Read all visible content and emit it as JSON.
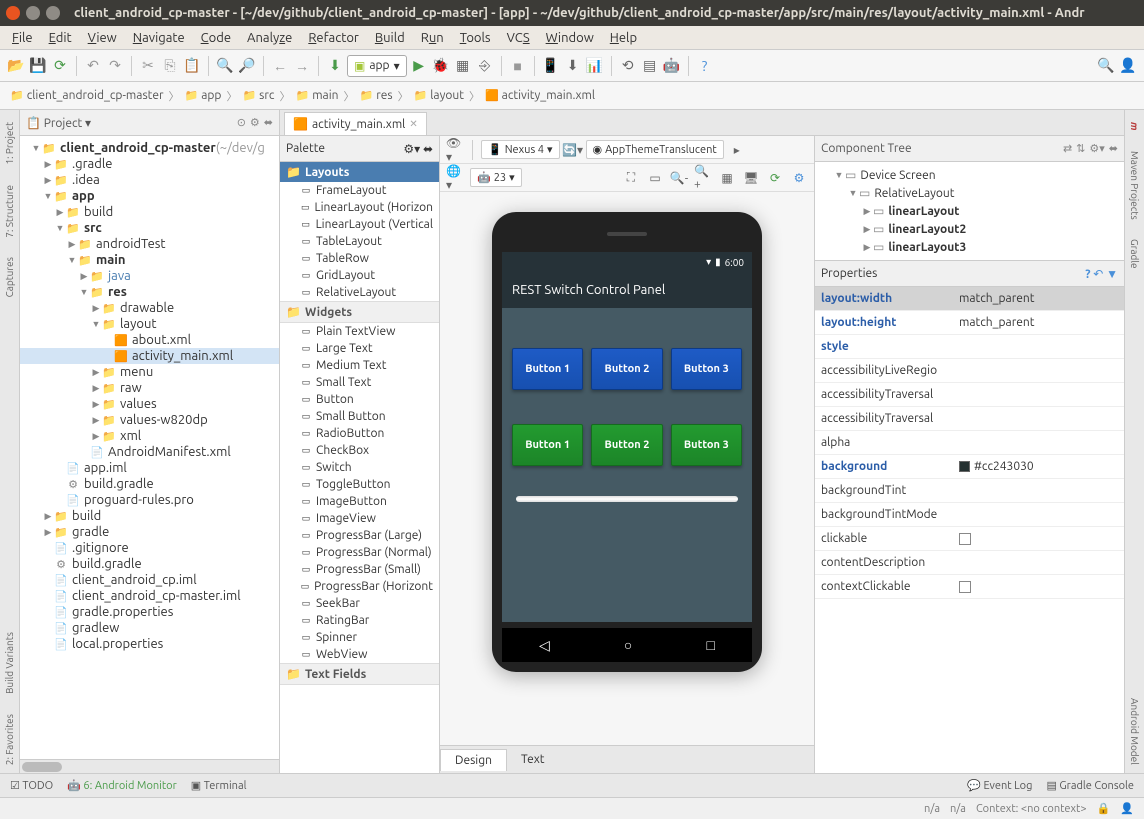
{
  "window": {
    "title": "client_android_cp-master - [~/dev/github/client_android_cp-master] - [app] - ~/dev/github/client_android_cp-master/app/src/main/res/layout/activity_main.xml - Andr"
  },
  "menu": [
    "File",
    "Edit",
    "View",
    "Navigate",
    "Code",
    "Analyze",
    "Refactor",
    "Build",
    "Run",
    "Tools",
    "VCS",
    "Window",
    "Help"
  ],
  "toolbar_app_combo": "app",
  "breadcrumb": [
    {
      "icon": "📁",
      "label": "client_android_cp-master"
    },
    {
      "icon": "📁",
      "label": "app"
    },
    {
      "icon": "📁",
      "label": "src"
    },
    {
      "icon": "📁",
      "label": "main"
    },
    {
      "icon": "📁",
      "label": "res"
    },
    {
      "icon": "📁",
      "label": "layout"
    },
    {
      "icon": "🟧",
      "label": "activity_main.xml"
    }
  ],
  "left_tabs": [
    "1: Project",
    "7: Structure",
    "Captures",
    "Build Variants",
    "2: Favorites"
  ],
  "right_tabs": [
    "Maven Projects",
    "Gradle",
    "Android Model"
  ],
  "project_panel": {
    "header": "Project",
    "tree": [
      {
        "pad": 1,
        "toggle": "▼",
        "ico": "📁",
        "label": "client_android_cp-master",
        "extra": " (~/dev/g",
        "bold": true
      },
      {
        "pad": 2,
        "toggle": "▶",
        "ico": "📁",
        "label": ".gradle"
      },
      {
        "pad": 2,
        "toggle": "▶",
        "ico": "📁",
        "label": ".idea"
      },
      {
        "pad": 2,
        "toggle": "▼",
        "ico": "📁",
        "label": "app",
        "bold": true
      },
      {
        "pad": 3,
        "toggle": "▶",
        "ico": "📁",
        "label": "build"
      },
      {
        "pad": 3,
        "toggle": "▼",
        "ico": "📁",
        "label": "src",
        "bold": true
      },
      {
        "pad": 4,
        "toggle": "▶",
        "ico": "📁",
        "label": "androidTest"
      },
      {
        "pad": 4,
        "toggle": "▼",
        "ico": "📁",
        "label": "main",
        "bold": true
      },
      {
        "pad": 5,
        "toggle": "▶",
        "ico": "📁",
        "label": "java",
        "blue": true
      },
      {
        "pad": 5,
        "toggle": "▼",
        "ico": "📁",
        "label": "res",
        "bold": true
      },
      {
        "pad": 6,
        "toggle": "▶",
        "ico": "📁",
        "label": "drawable"
      },
      {
        "pad": 6,
        "toggle": "▼",
        "ico": "📁",
        "label": "layout"
      },
      {
        "pad": 7,
        "toggle": "",
        "ico": "🟧",
        "label": "about.xml"
      },
      {
        "pad": 7,
        "toggle": "",
        "ico": "🟧",
        "label": "activity_main.xml",
        "selected": true
      },
      {
        "pad": 6,
        "toggle": "▶",
        "ico": "📁",
        "label": "menu"
      },
      {
        "pad": 6,
        "toggle": "▶",
        "ico": "📁",
        "label": "raw"
      },
      {
        "pad": 6,
        "toggle": "▶",
        "ico": "📁",
        "label": "values"
      },
      {
        "pad": 6,
        "toggle": "▶",
        "ico": "📁",
        "label": "values-w820dp"
      },
      {
        "pad": 6,
        "toggle": "▶",
        "ico": "📁",
        "label": "xml"
      },
      {
        "pad": 5,
        "toggle": "",
        "ico": "📄",
        "label": "AndroidManifest.xml"
      },
      {
        "pad": 3,
        "toggle": "",
        "ico": "📄",
        "label": "app.iml"
      },
      {
        "pad": 3,
        "toggle": "",
        "ico": "⚙",
        "label": "build.gradle"
      },
      {
        "pad": 3,
        "toggle": "",
        "ico": "📄",
        "label": "proguard-rules.pro"
      },
      {
        "pad": 2,
        "toggle": "▶",
        "ico": "📁",
        "label": "build"
      },
      {
        "pad": 2,
        "toggle": "▶",
        "ico": "📁",
        "label": "gradle"
      },
      {
        "pad": 2,
        "toggle": "",
        "ico": "📄",
        "label": ".gitignore"
      },
      {
        "pad": 2,
        "toggle": "",
        "ico": "⚙",
        "label": "build.gradle"
      },
      {
        "pad": 2,
        "toggle": "",
        "ico": "📄",
        "label": "client_android_cp.iml"
      },
      {
        "pad": 2,
        "toggle": "",
        "ico": "📄",
        "label": "client_android_cp-master.iml"
      },
      {
        "pad": 2,
        "toggle": "",
        "ico": "📄",
        "label": "gradle.properties"
      },
      {
        "pad": 2,
        "toggle": "",
        "ico": "📄",
        "label": "gradlew"
      },
      {
        "pad": 2,
        "toggle": "",
        "ico": "📄",
        "label": "local.properties"
      }
    ]
  },
  "editor_tab": "activity_main.xml",
  "palette": {
    "header": "Palette",
    "groups": [
      {
        "name": "Layouts",
        "style": "primary",
        "items": [
          "FrameLayout",
          "LinearLayout (Horizon",
          "LinearLayout (Vertical",
          "TableLayout",
          "TableRow",
          "GridLayout",
          "RelativeLayout"
        ]
      },
      {
        "name": "Widgets",
        "style": "secondary",
        "items": [
          "Plain TextView",
          "Large Text",
          "Medium Text",
          "Small Text",
          "Button",
          "Small Button",
          "RadioButton",
          "CheckBox",
          "Switch",
          "ToggleButton",
          "ImageButton",
          "ImageView",
          "ProgressBar (Large)",
          "ProgressBar (Normal)",
          "ProgressBar (Small)",
          "ProgressBar (Horizont",
          "SeekBar",
          "RatingBar",
          "Spinner",
          "WebView"
        ]
      },
      {
        "name": "Text Fields",
        "style": "secondary",
        "items": []
      }
    ]
  },
  "designer": {
    "device": "Nexus 4",
    "theme": "AppThemeTranslucent",
    "api": "23",
    "app_title": "REST Switch Control Panel",
    "status_time": "6:00",
    "row1": [
      "Button 1",
      "Button 2",
      "Button 3"
    ],
    "row2": [
      "Button 1",
      "Button 2",
      "Button 3"
    ],
    "footer_tabs": [
      "Design",
      "Text"
    ]
  },
  "component_tree": {
    "header": "Component Tree",
    "items": [
      {
        "pad": 1,
        "toggle": "▼",
        "label": "Device Screen"
      },
      {
        "pad": 2,
        "toggle": "▼",
        "label": "RelativeLayout"
      },
      {
        "pad": 3,
        "toggle": "▶",
        "label": "linearLayout",
        "bold": true
      },
      {
        "pad": 3,
        "toggle": "▶",
        "label": "linearLayout2",
        "bold": true
      },
      {
        "pad": 3,
        "toggle": "▶",
        "label": "linearLayout3",
        "bold": true
      }
    ]
  },
  "properties": {
    "header": "Properties",
    "rows": [
      {
        "key": "layout:width",
        "val": "match_parent",
        "bold": true,
        "sel": true
      },
      {
        "key": "layout:height",
        "val": "match_parent",
        "bold": true
      },
      {
        "key": "style",
        "val": "",
        "bold": true
      },
      {
        "key": "accessibilityLiveRegio",
        "val": ""
      },
      {
        "key": "accessibilityTraversal",
        "val": ""
      },
      {
        "key": "accessibilityTraversal",
        "val": ""
      },
      {
        "key": "alpha",
        "val": ""
      },
      {
        "key": "background",
        "val": "#cc243030",
        "bold": true,
        "swatch": true
      },
      {
        "key": "backgroundTint",
        "val": ""
      },
      {
        "key": "backgroundTintMode",
        "val": ""
      },
      {
        "key": "clickable",
        "val": "",
        "checkbox": true
      },
      {
        "key": "contentDescription",
        "val": ""
      },
      {
        "key": "contextClickable",
        "val": "",
        "checkbox": true
      }
    ]
  },
  "bottom": {
    "items": [
      "TODO",
      "6: Android Monitor",
      "Terminal"
    ],
    "right": [
      "Event Log",
      "Gradle Console"
    ]
  },
  "status": {
    "left": "n/a",
    "right": "n/a",
    "context": "Context: <no context>"
  }
}
